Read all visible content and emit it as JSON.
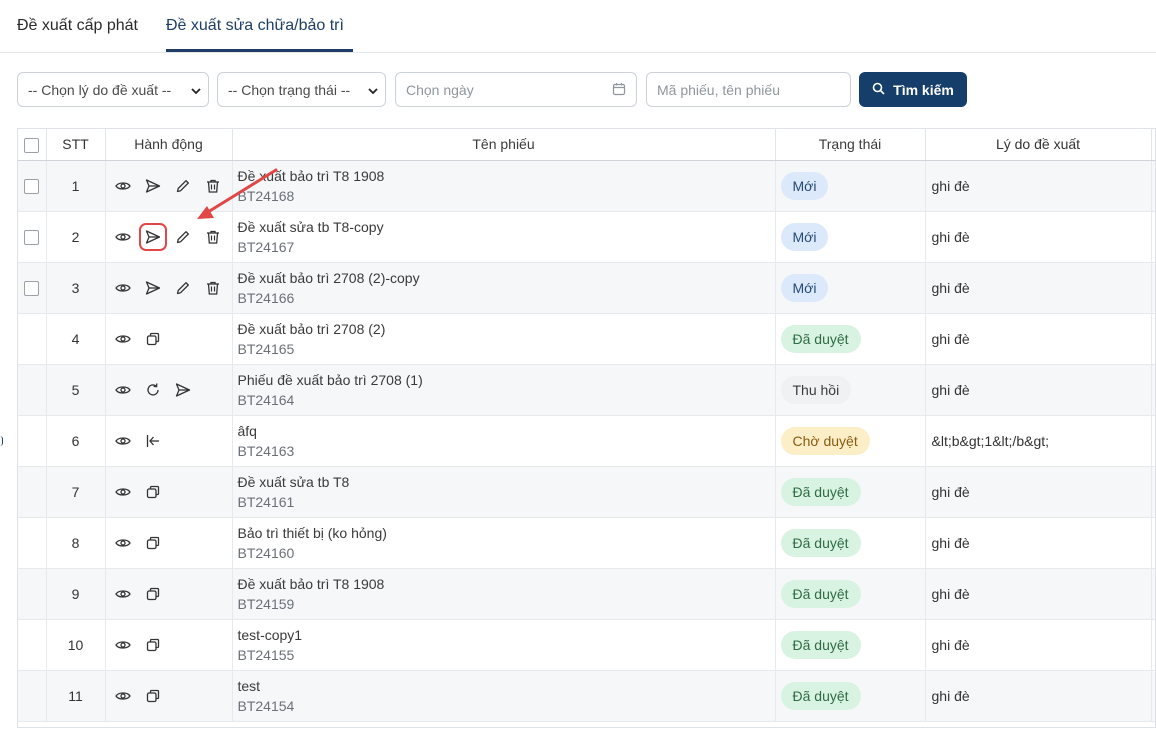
{
  "tabs": [
    {
      "label": "Đề xuất cấp phát",
      "active": false
    },
    {
      "label": "Đề xuất sửa chữa/bảo trì",
      "active": true
    }
  ],
  "filters": {
    "reason_select": "-- Chọn lý do đề xuất --",
    "status_select": "-- Chọn trạng thái --",
    "date_placeholder": "Chọn ngày",
    "keyword_placeholder": "Mã phiếu, tên phiếu",
    "search_label": "Tìm kiếm"
  },
  "table": {
    "headers": {
      "stt": "STT",
      "actions": "Hành động",
      "name": "Tên phiếu",
      "status": "Trạng thái",
      "reason": "Lý do đề xuất"
    },
    "rows": [
      {
        "stt": "1",
        "title": "Đề xuất bảo trì T8 1908",
        "code": "BT24168",
        "status": "Mới",
        "reason": "ghi đè",
        "checkbox": true,
        "actions": [
          "eye",
          "send",
          "edit",
          "trash"
        ]
      },
      {
        "stt": "2",
        "title": "Đề xuất sửa tb T8-copy",
        "code": "BT24167",
        "status": "Mới",
        "reason": "ghi đè",
        "checkbox": true,
        "actions": [
          "eye",
          "send",
          "edit",
          "trash"
        ],
        "highlight": "send"
      },
      {
        "stt": "3",
        "title": "Đề xuất bảo trì 2708 (2)-copy",
        "code": "BT24166",
        "status": "Mới",
        "reason": "ghi đè",
        "checkbox": true,
        "actions": [
          "eye",
          "send",
          "edit",
          "trash"
        ]
      },
      {
        "stt": "4",
        "title": "Đề xuất bảo trì 2708 (2)",
        "code": "BT24165",
        "status": "Đã duyệt",
        "reason": "ghi đè",
        "checkbox": false,
        "actions": [
          "eye",
          "copy"
        ]
      },
      {
        "stt": "5",
        "title": "Phiếu đề xuất bảo trì 2708 (1)",
        "code": "BT24164",
        "status": "Thu hồi",
        "reason": "ghi đè",
        "checkbox": false,
        "actions": [
          "eye",
          "refresh",
          "send"
        ]
      },
      {
        "stt": "6",
        "title": "âfq",
        "code": "BT24163",
        "status": "Chờ duyệt",
        "reason": "&lt;b&gt;1&lt;/b&gt;",
        "checkbox": false,
        "actions": [
          "eye",
          "recall"
        ]
      },
      {
        "stt": "7",
        "title": "Đề xuất sửa tb T8",
        "code": "BT24161",
        "status": "Đã duyệt",
        "reason": "ghi đè",
        "checkbox": false,
        "actions": [
          "eye",
          "copy"
        ]
      },
      {
        "stt": "8",
        "title": "Bảo trì thiết bị (ko hỏng)",
        "code": "BT24160",
        "status": "Đã duyệt",
        "reason": "ghi đè",
        "checkbox": false,
        "actions": [
          "eye",
          "copy"
        ]
      },
      {
        "stt": "9",
        "title": "Đề xuất bảo trì T8 1908",
        "code": "BT24159",
        "status": "Đã duyệt",
        "reason": "ghi đè",
        "checkbox": false,
        "actions": [
          "eye",
          "copy"
        ]
      },
      {
        "stt": "10",
        "title": "test-copy1",
        "code": "BT24155",
        "status": "Đã duyệt",
        "reason": "ghi đè",
        "checkbox": false,
        "actions": [
          "eye",
          "copy"
        ]
      },
      {
        "stt": "11",
        "title": "test",
        "code": "BT24154",
        "status": "Đã duyệt",
        "reason": "ghi đè",
        "checkbox": false,
        "actions": [
          "eye",
          "copy"
        ]
      }
    ]
  },
  "colors": {
    "primary": "#163e6b",
    "badge_new": "#dbe9fb",
    "badge_approved": "#d9f3e2",
    "badge_pending": "#fcefc8",
    "badge_recalled": "#f0f1f3",
    "annotation": "#e04848"
  }
}
